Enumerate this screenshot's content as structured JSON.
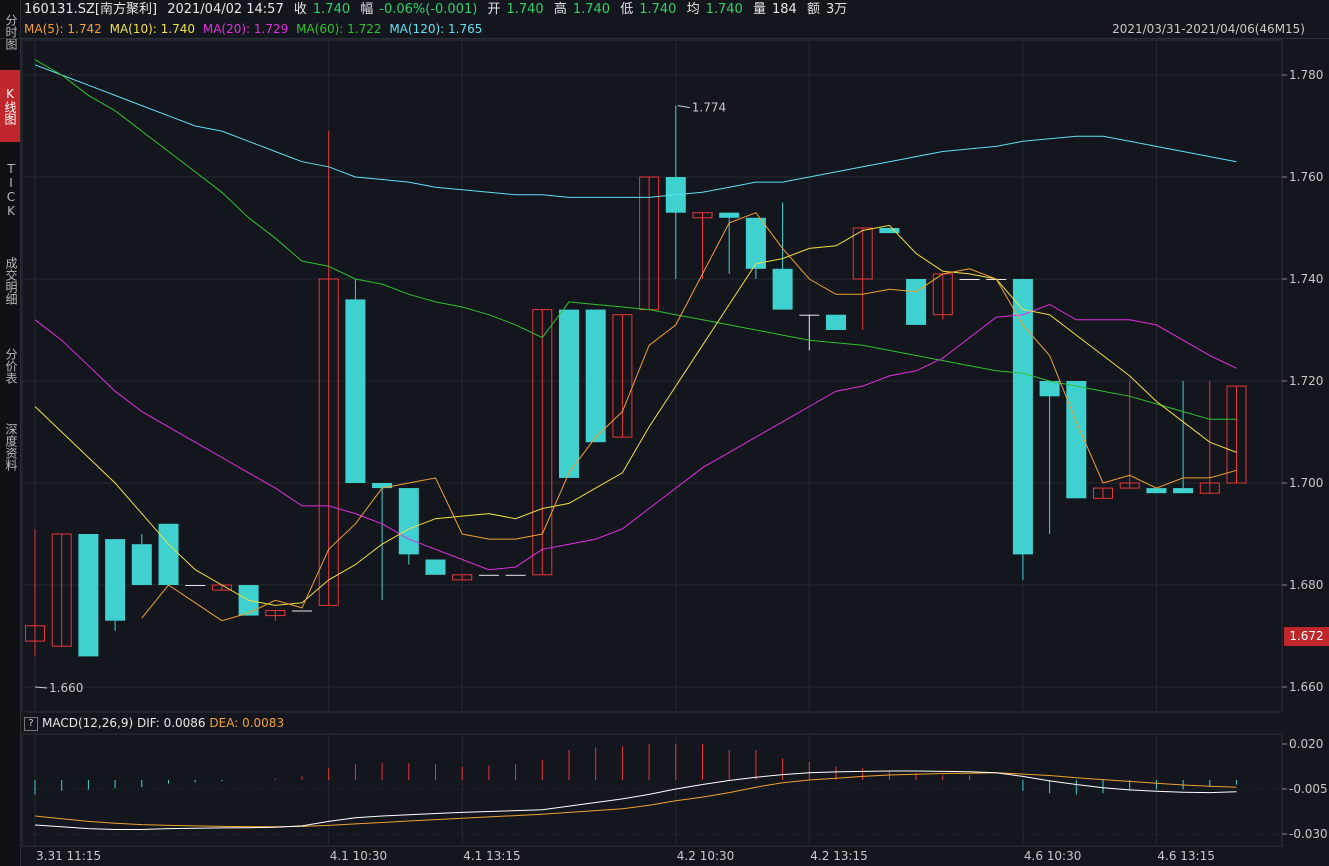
{
  "sidebar": {
    "tabs": [
      {
        "label": "分时图",
        "active": false
      },
      {
        "label": "K线图",
        "active": true
      },
      {
        "label": "TICK",
        "active": false
      },
      {
        "label": "成交明细",
        "active": false
      },
      {
        "label": "分价表",
        "active": false
      },
      {
        "label": "深度资料",
        "active": false
      }
    ]
  },
  "header": {
    "code": "160131.SZ[南方聚利]",
    "datetime": "2021/04/02 14:57",
    "close_label": "收",
    "close": "1.740",
    "change_label": "幅",
    "change": "-0.06%(-0.001)",
    "open_label": "开",
    "open": "1.740",
    "high_label": "高",
    "high": "1.740",
    "low_label": "低",
    "low": "1.740",
    "avg_label": "均",
    "avg": "1.740",
    "vol_label": "量",
    "vol": "184",
    "amt_label": "额",
    "amt": "3万"
  },
  "ma": {
    "ma5": "MA(5): 1.742",
    "ma10": "MA(10): 1.740",
    "ma20": "MA(20): 1.729",
    "ma60": "MA(60): 1.722",
    "ma120": "MA(120): 1.765",
    "range": "2021/03/31-2021/04/06(46M15)"
  },
  "macd_header": {
    "help": "?",
    "name": "MACD(12,26,9)",
    "dif": "DIF: 0.0086",
    "dea": "DEA: 0.0083"
  },
  "annotations": {
    "high_mark": "1.774",
    "low_mark": "1.660",
    "current_price": "1.672"
  },
  "colors": {
    "up": "#e8363a",
    "down": "#3fd0d0",
    "ma5": "#f0a030",
    "ma10": "#f0e040",
    "ma20": "#e030e0",
    "ma60": "#30c030",
    "ma120": "#60e0f0",
    "dif": "#ffffff",
    "dea": "#f0a030"
  },
  "chart_data": [
    {
      "type": "candlestick",
      "price_axis": {
        "ticks": [
          "1.780",
          "1.760",
          "1.740",
          "1.720",
          "1.700",
          "1.680",
          "1.660"
        ],
        "ylim": [
          1.656,
          1.7845
        ]
      },
      "x_labels": [
        {
          "i": 0,
          "text": "3.31 11:15"
        },
        {
          "i": 11,
          "text": "4.1 10:30"
        },
        {
          "i": 16,
          "text": "4.1 13:15"
        },
        {
          "i": 24,
          "text": "4.2 10:30"
        },
        {
          "i": 29,
          "text": "4.2 13:15"
        },
        {
          "i": 37,
          "text": "4.6 10:30"
        },
        {
          "i": 42,
          "text": "4.6 13:15"
        }
      ],
      "candles": [
        [
          1.669,
          1.672,
          1.691,
          1.666
        ],
        [
          1.668,
          1.69,
          1.69,
          1.668
        ],
        [
          1.69,
          1.666,
          1.69,
          1.666
        ],
        [
          1.689,
          1.673,
          1.689,
          1.671
        ],
        [
          1.688,
          1.68,
          1.69,
          1.68
        ],
        [
          1.692,
          1.68,
          1.692,
          1.68
        ],
        [
          1.68,
          1.68,
          1.68,
          1.68
        ],
        [
          1.679,
          1.68,
          1.68,
          1.679
        ],
        [
          1.68,
          1.674,
          1.68,
          1.674
        ],
        [
          1.674,
          1.675,
          1.675,
          1.673
        ],
        [
          1.675,
          1.675,
          1.675,
          1.675
        ],
        [
          1.676,
          1.74,
          1.769,
          1.676
        ],
        [
          1.736,
          1.7,
          1.74,
          1.7
        ],
        [
          1.7,
          1.699,
          1.7,
          1.677
        ],
        [
          1.699,
          1.686,
          1.699,
          1.684
        ],
        [
          1.685,
          1.682,
          1.685,
          1.682
        ],
        [
          1.681,
          1.682,
          1.682,
          1.681
        ],
        [
          1.682,
          1.682,
          1.682,
          1.682
        ],
        [
          1.682,
          1.682,
          1.682,
          1.682
        ],
        [
          1.682,
          1.734,
          1.734,
          1.682
        ],
        [
          1.734,
          1.701,
          1.734,
          1.701
        ],
        [
          1.734,
          1.708,
          1.734,
          1.708
        ],
        [
          1.709,
          1.733,
          1.733,
          1.709
        ],
        [
          1.734,
          1.76,
          1.76,
          1.734
        ],
        [
          1.76,
          1.753,
          1.774,
          1.74
        ],
        [
          1.752,
          1.753,
          1.753,
          1.74
        ],
        [
          1.753,
          1.752,
          1.753,
          1.741
        ],
        [
          1.752,
          1.742,
          1.752,
          1.74
        ],
        [
          1.742,
          1.734,
          1.755,
          1.734
        ],
        [
          1.733,
          1.733,
          1.733,
          1.726
        ],
        [
          1.733,
          1.73,
          1.733,
          1.73
        ],
        [
          1.74,
          1.75,
          1.75,
          1.73
        ],
        [
          1.75,
          1.749,
          1.75,
          1.749
        ],
        [
          1.74,
          1.731,
          1.74,
          1.731
        ],
        [
          1.733,
          1.741,
          1.741,
          1.732
        ],
        [
          1.74,
          1.74,
          1.74,
          1.74
        ],
        [
          1.74,
          1.74,
          1.74,
          1.74
        ],
        [
          1.74,
          1.686,
          1.74,
          1.681
        ],
        [
          1.72,
          1.717,
          1.72,
          1.69
        ],
        [
          1.72,
          1.697,
          1.72,
          1.697
        ],
        [
          1.697,
          1.699,
          1.699,
          1.697
        ],
        [
          1.699,
          1.7,
          1.72,
          1.699
        ],
        [
          1.699,
          1.698,
          1.699,
          1.698
        ],
        [
          1.699,
          1.698,
          1.72,
          1.698
        ],
        [
          1.698,
          1.7,
          1.72,
          1.698
        ],
        [
          1.7,
          1.719,
          1.719,
          1.7
        ]
      ],
      "ma5": [
        null,
        null,
        null,
        null,
        1.6735,
        1.68,
        1.6765,
        1.673,
        1.6745,
        1.677,
        1.6755,
        1.687,
        1.692,
        1.699,
        1.7,
        1.701,
        1.69,
        1.689,
        1.689,
        1.69,
        1.702,
        1.709,
        1.714,
        1.727,
        1.731,
        1.741,
        1.751,
        1.753,
        1.746,
        1.74,
        1.737,
        1.737,
        1.738,
        1.7375,
        1.741,
        1.742,
        1.74,
        1.731,
        1.725,
        1.712,
        1.7,
        1.7015,
        1.699,
        1.701,
        1.701,
        1.7025
      ],
      "ma10": [
        1.715,
        1.71,
        1.705,
        1.7,
        1.694,
        1.688,
        1.683,
        1.68,
        1.677,
        1.676,
        1.6765,
        1.681,
        1.684,
        1.688,
        1.691,
        1.693,
        1.6935,
        1.694,
        1.693,
        1.695,
        1.696,
        1.699,
        1.702,
        1.711,
        1.719,
        1.727,
        1.735,
        1.743,
        1.744,
        1.746,
        1.7465,
        1.7495,
        1.7505,
        1.745,
        1.7415,
        1.741,
        1.74,
        1.734,
        1.733,
        1.729,
        1.725,
        1.721,
        1.716,
        1.712,
        1.708,
        1.706
      ],
      "ma20": [
        1.732,
        1.728,
        1.723,
        1.718,
        1.714,
        1.711,
        1.708,
        1.705,
        1.702,
        1.699,
        1.6955,
        1.6955,
        1.694,
        1.692,
        1.689,
        1.687,
        1.685,
        1.683,
        1.6835,
        1.687,
        1.688,
        1.689,
        1.691,
        1.695,
        1.699,
        1.703,
        1.706,
        1.709,
        1.712,
        1.715,
        1.718,
        1.719,
        1.721,
        1.722,
        1.7245,
        1.7285,
        1.7325,
        1.733,
        1.735,
        1.732,
        1.732,
        1.732,
        1.731,
        1.728,
        1.725,
        1.7225
      ],
      "ma60": [
        1.783,
        1.78,
        1.776,
        1.773,
        1.769,
        1.765,
        1.761,
        1.757,
        1.752,
        1.748,
        1.7435,
        1.7425,
        1.74,
        1.739,
        1.737,
        1.7355,
        1.7345,
        1.733,
        1.731,
        1.7285,
        1.7355,
        1.735,
        1.7345,
        1.734,
        1.733,
        1.732,
        1.731,
        1.73,
        1.729,
        1.728,
        1.7275,
        1.727,
        1.726,
        1.725,
        1.724,
        1.723,
        1.722,
        1.7215,
        1.72,
        1.719,
        1.718,
        1.717,
        1.7155,
        1.714,
        1.7125,
        1.7125
      ],
      "ma120": [
        1.782,
        1.78,
        1.778,
        1.776,
        1.774,
        1.772,
        1.77,
        1.769,
        1.767,
        1.765,
        1.763,
        1.762,
        1.76,
        1.7595,
        1.759,
        1.758,
        1.7575,
        1.757,
        1.7565,
        1.7565,
        1.756,
        1.756,
        1.756,
        1.756,
        1.7565,
        1.757,
        1.758,
        1.759,
        1.759,
        1.76,
        1.761,
        1.762,
        1.763,
        1.764,
        1.765,
        1.7655,
        1.766,
        1.767,
        1.7675,
        1.768,
        1.768,
        1.767,
        1.766,
        1.765,
        1.764,
        1.763
      ]
    },
    {
      "type": "macd",
      "y_ticks": [
        "0.020",
        "-0.005",
        "-0.030"
      ],
      "ylim": [
        -0.0325,
        0.0285
      ],
      "dif": [
        -0.025,
        -0.026,
        -0.027,
        -0.0275,
        -0.0275,
        -0.027,
        -0.0268,
        -0.0266,
        -0.0265,
        -0.0263,
        -0.0255,
        -0.023,
        -0.021,
        -0.02,
        -0.0193,
        -0.0186,
        -0.018,
        -0.0175,
        -0.017,
        -0.0165,
        -0.0145,
        -0.0125,
        -0.0105,
        -0.008,
        -0.005,
        -0.0025,
        -0.0003,
        0.0015,
        0.003,
        0.004,
        0.0045,
        0.0048,
        0.005,
        0.005,
        0.0048,
        0.0046,
        0.004,
        0.002,
        -0.0005,
        -0.0025,
        -0.0043,
        -0.0055,
        -0.0063,
        -0.0068,
        -0.007,
        -0.0065
      ],
      "dea": [
        -0.02,
        -0.0215,
        -0.023,
        -0.024,
        -0.0248,
        -0.0252,
        -0.0255,
        -0.0258,
        -0.0259,
        -0.026,
        -0.0258,
        -0.0252,
        -0.0244,
        -0.0236,
        -0.0228,
        -0.022,
        -0.0212,
        -0.0205,
        -0.0198,
        -0.019,
        -0.018,
        -0.017,
        -0.016,
        -0.014,
        -0.0115,
        -0.0095,
        -0.007,
        -0.004,
        -0.0015,
        0.0,
        0.001,
        0.002,
        0.0028,
        0.0032,
        0.0036,
        0.0038,
        0.004,
        0.0033,
        0.0025,
        0.0013,
        0.0002,
        -0.0008,
        -0.0018,
        -0.0028,
        -0.0035,
        -0.004
      ],
      "hist": [
        -0.012,
        -0.009,
        -0.008,
        -0.007,
        -0.006,
        -0.003,
        -0.002,
        -0.001,
        0.0,
        0.001,
        0.003,
        0.01,
        0.013,
        0.014,
        0.014,
        0.013,
        0.011,
        0.012,
        0.013,
        0.017,
        0.025,
        0.027,
        0.028,
        0.03,
        0.03,
        0.03,
        0.025,
        0.025,
        0.018,
        0.015,
        0.011,
        0.01,
        0.008,
        0.006,
        0.004,
        0.004,
        0.0,
        -0.009,
        -0.011,
        -0.012,
        -0.011,
        -0.009,
        -0.008,
        -0.008,
        -0.006,
        -0.004
      ]
    }
  ]
}
